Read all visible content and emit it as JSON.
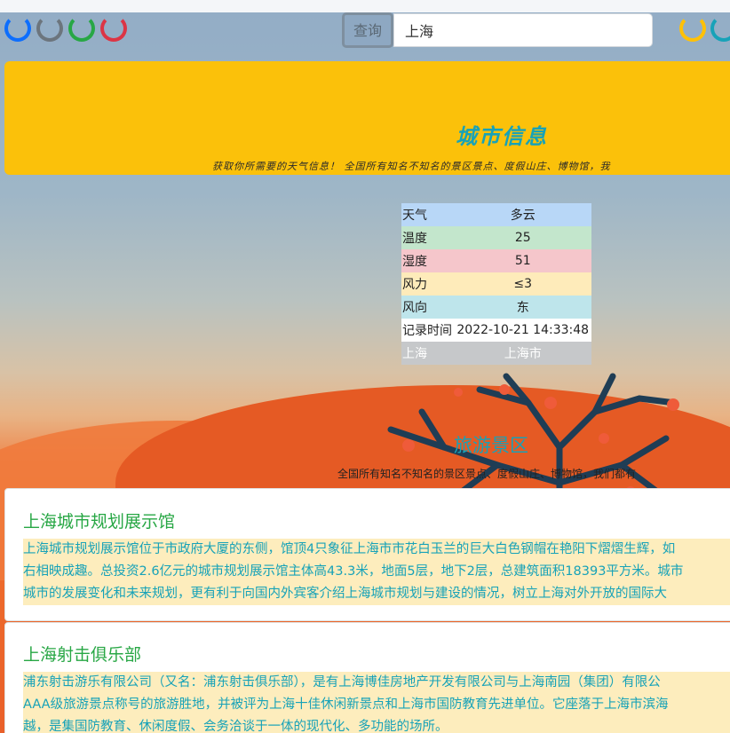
{
  "search": {
    "button_label": "查询",
    "input_value": "上海"
  },
  "spinners": {
    "colors": [
      "#0d6efd",
      "#6c757d",
      "#28a745",
      "#dc3545",
      "#ffc107",
      "#17a2b8"
    ]
  },
  "banner": {
    "title": "城市信息",
    "subtitle": "获取你所需要的天气信息！ 全国所有知名不知名的景区景点、度假山庄、博物馆，我"
  },
  "weather": {
    "rows": [
      {
        "label": "天气",
        "value": "多云",
        "color": "#b8d7f7"
      },
      {
        "label": "温度",
        "value": "25",
        "color": "#c3e6cc"
      },
      {
        "label": "湿度",
        "value": "51",
        "color": "#f5c6cb"
      },
      {
        "label": "风力",
        "value": "≤3",
        "color": "#feebba"
      },
      {
        "label": "风向",
        "value": "东",
        "color": "#bee5eb"
      },
      {
        "label": "记录时间",
        "value": "2022-10-21 14:33:48",
        "color": "#ffffff"
      },
      {
        "label": "上海",
        "value": "上海市",
        "color": "#c6c8ca"
      }
    ]
  },
  "tourism": {
    "title": "旅游景区",
    "subtitle": "全国所有知名不知名的景区景点、度假山庄、博物馆，我们都有"
  },
  "attractions": [
    {
      "name": "上海城市规划展示馆",
      "lines": [
        "上海城市规划展示馆位于市政府大厦的东侧，馆顶4只象征上海市市花白玉兰的巨大白色钢帽在艳阳下熠熠生辉，如",
        "右相映成趣。总投资2.6亿元的城市规划展示馆主体高43.3米，地面5层，地下2层，总建筑面积18393平方米。城市",
        "城市的发展变化和未来规划，更有利于向国内外宾客介绍上海城市规划与建设的情况，树立上海对外开放的国际大"
      ]
    },
    {
      "name": "上海射击俱乐部",
      "lines": [
        "浦东射击游乐有限公司（又名：浦东射击俱乐部），是有上海博佳房地产开发有限公司与上海南园（集团）有限公",
        "AAA级旅游景点称号的旅游胜地，并被评为上海十佳休闲新景点和上海市国防教育先进单位。它座落于上海市滨海",
        "越，是集国防教育、休闲度假、会务洽谈于一体的现代化、多功能的场所。"
      ]
    }
  ]
}
